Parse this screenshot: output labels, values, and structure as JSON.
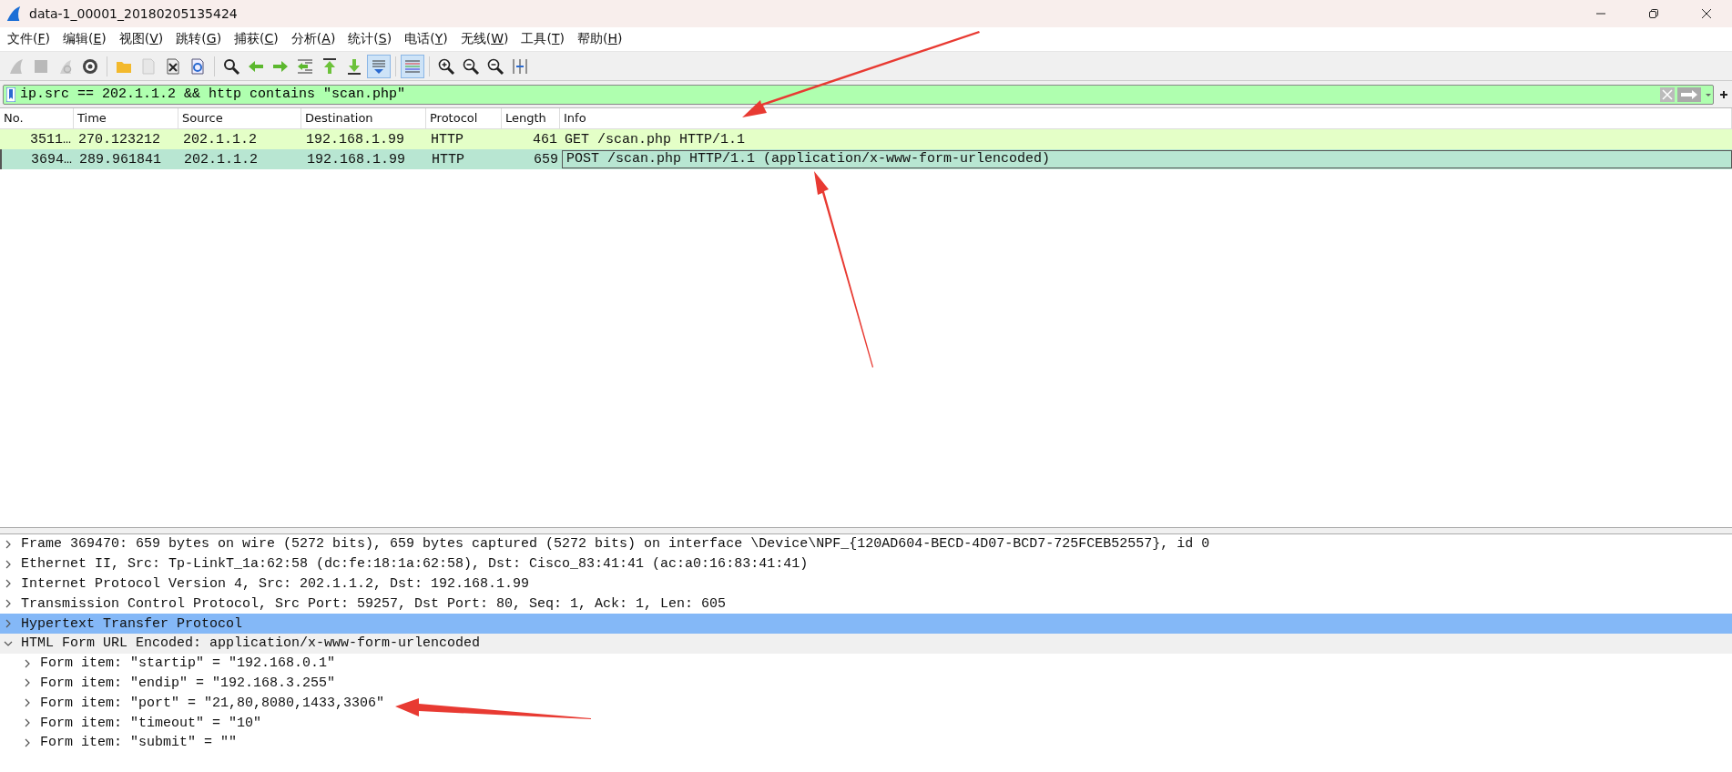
{
  "window": {
    "title": "data-1_00001_20180205135424"
  },
  "menu": [
    "文件(F)",
    "编辑(E)",
    "视图(V)",
    "跳转(G)",
    "捕获(C)",
    "分析(A)",
    "统计(S)",
    "电话(Y)",
    "无线(W)",
    "工具(T)",
    "帮助(H)"
  ],
  "toolbar": [
    {
      "disabled": true,
      "pressed": false
    },
    {
      "disabled": true,
      "pressed": false
    },
    {
      "disabled": true,
      "pressed": false
    },
    {
      "disabled": false,
      "pressed": false
    },
    {
      "disabled": false,
      "pressed": false
    },
    {
      "disabled": true,
      "pressed": false
    },
    {
      "disabled": false,
      "pressed": false
    },
    {
      "disabled": false,
      "pressed": false
    },
    {
      "disabled": false,
      "pressed": false
    },
    {
      "disabled": false,
      "pressed": false
    },
    {
      "disabled": false,
      "pressed": false
    },
    {
      "disabled": false,
      "pressed": false
    },
    {
      "disabled": false,
      "pressed": false
    },
    {
      "disabled": false,
      "pressed": false
    },
    {
      "disabled": false,
      "pressed": true
    },
    {
      "disabled": false,
      "pressed": true
    },
    {
      "disabled": false,
      "pressed": false
    },
    {
      "disabled": false,
      "pressed": false
    },
    {
      "disabled": false,
      "pressed": false
    },
    {
      "disabled": false,
      "pressed": false
    }
  ],
  "display_filter": {
    "value": "ip.src == 202.1.1.2 && http contains \"scan.php\""
  },
  "packet_list": {
    "columns": [
      "No.",
      "Time",
      "Source",
      "Destination",
      "Protocol",
      "Length",
      "Info"
    ],
    "rows": [
      {
        "selected": false,
        "cells": [
          "3511…",
          "270.123212",
          "202.1.1.2",
          "192.168.1.99",
          "HTTP",
          "461",
          "GET /scan.php HTTP/1.1"
        ]
      },
      {
        "selected": true,
        "cells": [
          "3694…",
          "289.961841",
          "202.1.1.2",
          "192.168.1.99",
          "HTTP",
          "659",
          "POST /scan.php HTTP/1.1  (application/x-www-form-urlencoded)"
        ]
      }
    ]
  },
  "details": [
    {
      "text": "Frame 369470: 659 bytes on wire (5272 bits), 659 bytes captured (5272 bits) on interface \\Device\\NPF_{120AD604-BECD-4D07-BCD7-725FCEB52557}, id 0",
      "expanded": false,
      "selected": false
    },
    {
      "text": "Ethernet II, Src: Tp-LinkT_1a:62:58 (dc:fe:18:1a:62:58), Dst: Cisco_83:41:41 (ac:a0:16:83:41:41)",
      "expanded": false,
      "selected": false
    },
    {
      "text": "Internet Protocol Version 4, Src: 202.1.1.2, Dst: 192.168.1.99",
      "expanded": false,
      "selected": false
    },
    {
      "text": "Transmission Control Protocol, Src Port: 59257, Dst Port: 80, Seq: 1, Ack: 1, Len: 605",
      "expanded": false,
      "selected": false
    },
    {
      "text": "Hypertext Transfer Protocol",
      "expanded": false,
      "selected": true
    },
    {
      "text": "HTML Form URL Encoded: application/x-www-form-urlencoded",
      "expanded": true,
      "selected": false,
      "children": [
        {
          "text": "Form item: \"startip\" = \"192.168.0.1\"",
          "expanded": false,
          "selected": false
        },
        {
          "text": "Form item: \"endip\" = \"192.168.3.255\"",
          "expanded": false,
          "selected": false
        },
        {
          "text": "Form item: \"port\" = \"21,80,8080,1433,3306\"",
          "expanded": false,
          "selected": false
        },
        {
          "text": "Form item: \"timeout\" = \"10\"",
          "expanded": false,
          "selected": false
        },
        {
          "text": "Form item: \"submit\" = \"\"",
          "expanded": false,
          "selected": false
        }
      ]
    }
  ]
}
